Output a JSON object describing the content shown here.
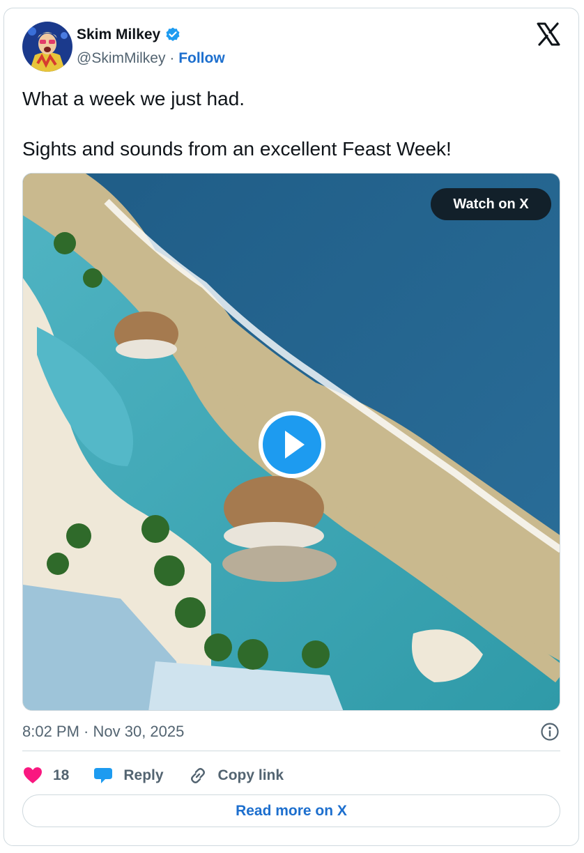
{
  "author": {
    "name": "Skim Milkey",
    "handle": "@SkimMilkey",
    "separator": "·",
    "follow_label": "Follow"
  },
  "tweet": {
    "lines": [
      "What a week we just had.",
      "Sights and sounds from an excellent Feast Week!"
    ]
  },
  "media": {
    "watch_label": "Watch on X"
  },
  "meta": {
    "timestamp": "8:02 PM · Nov 30, 2025"
  },
  "actions": {
    "like_count": "18",
    "reply_label": "Reply",
    "copy_label": "Copy link"
  },
  "footer": {
    "read_more_label": "Read more on X"
  },
  "colors": {
    "link_blue": "#1d6fce",
    "like_pink": "#f91880",
    "verified_blue": "#1d9bf0",
    "text_gray": "#536471"
  }
}
